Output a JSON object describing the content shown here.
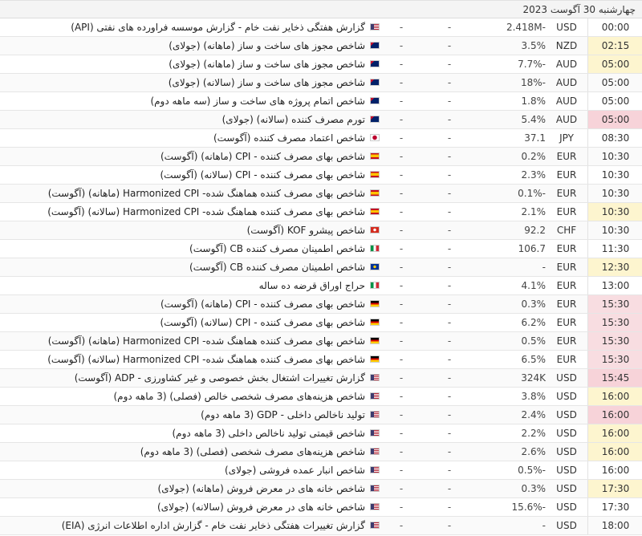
{
  "date_header": "چهارشنبه 30 آگوست 2023",
  "rows": [
    {
      "time": "00:00",
      "currency": "USD",
      "actual": "2.418M-",
      "forecast": "-",
      "previous": "-",
      "flag": "us",
      "name": "گزارش هفتگی ذخایر نفت خام - گزارش موسسه فراورده های نفتی (API)",
      "hl": ""
    },
    {
      "time": "02:15",
      "currency": "NZD",
      "actual": "3.5%",
      "forecast": "-",
      "previous": "-",
      "flag": "nz",
      "name": "شاخص مجوز های ساخت و ساز (ماهانه) (جولای)",
      "hl": "yellow"
    },
    {
      "time": "05:00",
      "currency": "AUD",
      "actual": "7.7%-",
      "forecast": "-",
      "previous": "-",
      "flag": "au",
      "name": "شاخص مجوز های ساخت و ساز (ماهانه) (جولای)",
      "hl": "yellow"
    },
    {
      "time": "05:00",
      "currency": "AUD",
      "actual": "18%-",
      "forecast": "-",
      "previous": "-",
      "flag": "au",
      "name": "شاخص مجوز های ساخت و ساز (سالانه) (جولای)",
      "hl": ""
    },
    {
      "time": "05:00",
      "currency": "AUD",
      "actual": "1.8%",
      "forecast": "-",
      "previous": "-",
      "flag": "au",
      "name": "شاخص اتمام پروژه های ساخت و ساز (سه ماهه دوم)",
      "hl": ""
    },
    {
      "time": "05:00",
      "currency": "AUD",
      "actual": "5.4%",
      "forecast": "-",
      "previous": "-",
      "flag": "au",
      "name": "تورم مصرف کننده (سالانه) (جولای)",
      "hl": "rose"
    },
    {
      "time": "08:30",
      "currency": "JPY",
      "actual": "37.1",
      "forecast": "-",
      "previous": "-",
      "flag": "jp",
      "name": "شاخص اعتماد مصرف کننده (آگوست)",
      "hl": ""
    },
    {
      "time": "10:30",
      "currency": "EUR",
      "actual": "0.2%",
      "forecast": "-",
      "previous": "-",
      "flag": "es",
      "name": "شاخص بهای مصرف کننده - CPI (ماهانه) (آگوست)",
      "hl": ""
    },
    {
      "time": "10:30",
      "currency": "EUR",
      "actual": "2.3%",
      "forecast": "-",
      "previous": "-",
      "flag": "es",
      "name": "شاخص بهای مصرف کننده - CPI (سالانه) (آگوست)",
      "hl": ""
    },
    {
      "time": "10:30",
      "currency": "EUR",
      "actual": "0.1%-",
      "forecast": "-",
      "previous": "-",
      "flag": "es",
      "name": "شاخص بهای مصرف کننده هماهنگ شده- Harmonized CPI (ماهانه) (آگوست)",
      "hl": ""
    },
    {
      "time": "10:30",
      "currency": "EUR",
      "actual": "2.1%",
      "forecast": "-",
      "previous": "-",
      "flag": "es",
      "name": "شاخص بهای مصرف کننده هماهنگ شده- Harmonized CPI (سالانه) (آگوست)",
      "hl": "yellow"
    },
    {
      "time": "10:30",
      "currency": "CHF",
      "actual": "92.2",
      "forecast": "-",
      "previous": "-",
      "flag": "ch",
      "name": "شاخص پیشرو KOF (آگوست)",
      "hl": ""
    },
    {
      "time": "11:30",
      "currency": "EUR",
      "actual": "106.7",
      "forecast": "-",
      "previous": "-",
      "flag": "it",
      "name": "شاخص اطمینان مصرف کننده CB (آگوست)",
      "hl": ""
    },
    {
      "time": "12:30",
      "currency": "EUR",
      "actual": "-",
      "forecast": "-",
      "previous": "-",
      "flag": "eu",
      "name": "شاخص اطمینان مصرف کننده CB (آگوست)",
      "hl": "yellow"
    },
    {
      "time": "13:00",
      "currency": "EUR",
      "actual": "4.1%",
      "forecast": "-",
      "previous": "-",
      "flag": "it",
      "name": "حراج اوراق قرضه ده ساله",
      "hl": ""
    },
    {
      "time": "15:30",
      "currency": "EUR",
      "actual": "0.3%",
      "forecast": "-",
      "previous": "-",
      "flag": "de",
      "name": "شاخص بهای مصرف کننده - CPI (ماهانه) (آگوست)",
      "hl": "pink"
    },
    {
      "time": "15:30",
      "currency": "EUR",
      "actual": "6.2%",
      "forecast": "-",
      "previous": "-",
      "flag": "de",
      "name": "شاخص بهای مصرف کننده - CPI (سالانه) (آگوست)",
      "hl": "pink"
    },
    {
      "time": "15:30",
      "currency": "EUR",
      "actual": "0.5%",
      "forecast": "-",
      "previous": "-",
      "flag": "de",
      "name": "شاخص بهای مصرف کننده هماهنگ شده- Harmonized CPI (ماهانه) (آگوست)",
      "hl": "pink"
    },
    {
      "time": "15:30",
      "currency": "EUR",
      "actual": "6.5%",
      "forecast": "-",
      "previous": "-",
      "flag": "de",
      "name": "شاخص بهای مصرف کننده هماهنگ شده- Harmonized CPI (سالانه) (آگوست)",
      "hl": "pink"
    },
    {
      "time": "15:45",
      "currency": "USD",
      "actual": "324K",
      "forecast": "-",
      "previous": "-",
      "flag": "us",
      "name": "گزارش تغییرات اشتغال بخش خصوصی و غیر کشاورزی - ADP (آگوست)",
      "hl": "rose"
    },
    {
      "time": "16:00",
      "currency": "USD",
      "actual": "3.8%",
      "forecast": "-",
      "previous": "-",
      "flag": "us",
      "name": "شاخص هزینه‌های مصرف شخصی خالص (فصلی) (3 ماهه دوم)",
      "hl": "yellow"
    },
    {
      "time": "16:00",
      "currency": "USD",
      "actual": "2.4%",
      "forecast": "-",
      "previous": "-",
      "flag": "us",
      "name": "تولید ناخالص داخلی - GDP (3 ماهه دوم)",
      "hl": "rose"
    },
    {
      "time": "16:00",
      "currency": "USD",
      "actual": "2.2%",
      "forecast": "-",
      "previous": "-",
      "flag": "us",
      "name": "شاخص قیمتی تولید ناخالص داخلی (3 ماهه دوم)",
      "hl": "yellow"
    },
    {
      "time": "16:00",
      "currency": "USD",
      "actual": "2.6%",
      "forecast": "-",
      "previous": "-",
      "flag": "us",
      "name": "شاخص هزینه‌های مصرف شخصی (فصلی) (3 ماهه دوم)",
      "hl": "yellow"
    },
    {
      "time": "16:00",
      "currency": "USD",
      "actual": "0.5%-",
      "forecast": "-",
      "previous": "-",
      "flag": "us",
      "name": "شاخص انبار عمده فروشی (جولای)",
      "hl": ""
    },
    {
      "time": "17:30",
      "currency": "USD",
      "actual": "0.3%",
      "forecast": "-",
      "previous": "-",
      "flag": "us",
      "name": "شاخص خانه های در معرض فروش (ماهانه) (جولای)",
      "hl": "yellow"
    },
    {
      "time": "17:30",
      "currency": "USD",
      "actual": "15.6%-",
      "forecast": "-",
      "previous": "-",
      "flag": "us",
      "name": "شاخص خانه های در معرض فروش (سالانه) (جولای)",
      "hl": ""
    },
    {
      "time": "18:00",
      "currency": "USD",
      "actual": "-",
      "forecast": "-",
      "previous": "-",
      "flag": "us",
      "name": "گزارش تغییرات هفتگی ذخایر نفت خام - گزارش اداره اطلاعات انرژی (EIA)",
      "hl": ""
    }
  ]
}
